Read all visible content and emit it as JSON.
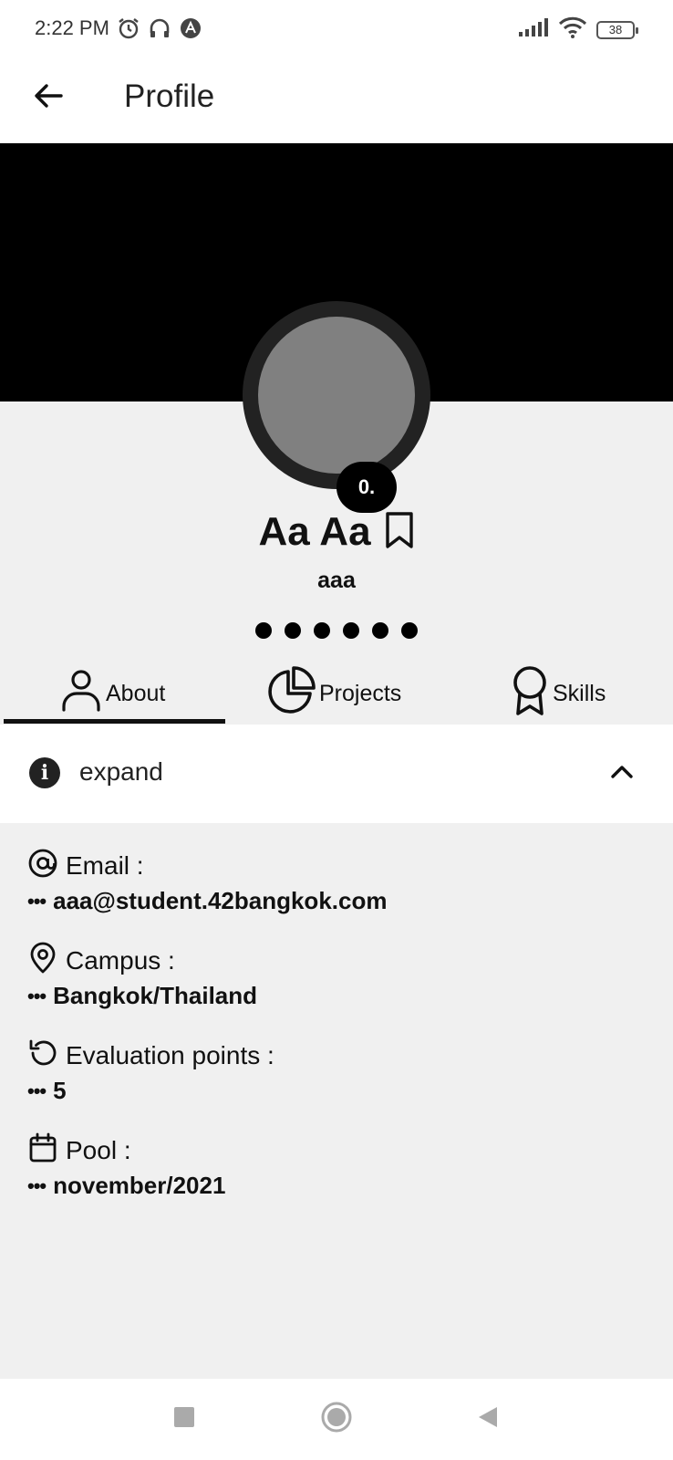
{
  "status_bar": {
    "time": "2:22 PM",
    "battery": "38",
    "icons": [
      "alarm-icon",
      "headset-icon",
      "app-notification-icon",
      "signal-icon",
      "wifi-icon",
      "battery-icon"
    ]
  },
  "app_bar": {
    "title": "Profile",
    "back_icon": "arrow-left-icon"
  },
  "profile": {
    "level_badge": "0.",
    "display_name": "Aa Aa",
    "login": "aaa",
    "bookmark_icon": "bookmark-icon"
  },
  "dots_count": 6,
  "tabs": [
    {
      "label": "About",
      "icon": "user-icon",
      "selected": true
    },
    {
      "label": "Projects",
      "icon": "pie-chart-icon",
      "selected": false
    },
    {
      "label": "Skills",
      "icon": "award-icon",
      "selected": false
    }
  ],
  "expand_section": {
    "label": "expand",
    "info_icon": "info-icon",
    "chevron_icon": "chevron-up-icon"
  },
  "details": [
    {
      "label": "Email :",
      "value": "aaa@student.42bangkok.com",
      "icon": "at-icon"
    },
    {
      "label": "Campus :",
      "value": "Bangkok/Thailand",
      "icon": "map-pin-icon"
    },
    {
      "label": "Evaluation points :",
      "value": "5",
      "icon": "history-icon"
    },
    {
      "label": "Pool :",
      "value": "november/2021",
      "icon": "calendar-icon"
    }
  ],
  "ellipsis": "•••",
  "nav_bar": [
    "recents-icon",
    "home-icon",
    "back-icon"
  ],
  "colors": {
    "banner": "#000000",
    "background": "#f0f0f0",
    "avatar": "#808080",
    "accent": "#111111"
  }
}
